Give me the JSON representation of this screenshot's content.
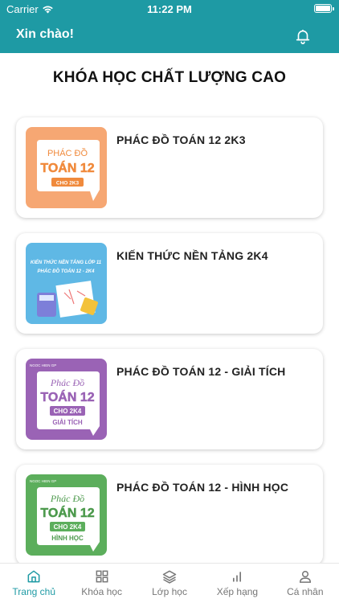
{
  "status_bar": {
    "carrier": "Carrier",
    "time": "11:22 PM"
  },
  "header": {
    "greeting": "Xin chào!",
    "bell_icon": "bell-icon"
  },
  "section": {
    "title": "KHÓA HỌC CHẤT LƯỢNG CAO"
  },
  "courses": [
    {
      "title": "PHÁC ĐỒ TOÁN 12 2K3",
      "thumb": {
        "line1": "PHÁC ĐỒ",
        "line2": "TOÁN 12",
        "line3": "CHO 2K3",
        "line4": "",
        "bg": "#f6a773"
      }
    },
    {
      "title": "KIẾN THỨC NỀN TẢNG 2K4",
      "thumb": {
        "line1": "KIẾN THỨC NỀN TẢNG LỚP 11",
        "line2": "PHÁC ĐỒ TOÁN 12 - 2K4",
        "bg": "#5fb8e5"
      }
    },
    {
      "title": "PHÁC ĐỒ TOÁN 12 - GIẢI TÍCH",
      "thumb": {
        "brand": "NGOC HIEN GP",
        "line1": "Phác Đồ",
        "line2": "TOÁN 12",
        "line3": "CHO 2K4",
        "line4": "GIẢI TÍCH",
        "bg": "#9a63b5"
      }
    },
    {
      "title": "PHÁC ĐỒ TOÁN 12 - HÌNH HỌC",
      "thumb": {
        "brand": "NGOC HIEN GP",
        "line1": "Phác Đồ",
        "line2": "TOÁN 12",
        "line3": "CHO 2K4",
        "line4": "HÌNH HỌC",
        "bg": "#5cae5c"
      }
    }
  ],
  "bottom_nav": [
    {
      "label": "Trang chủ",
      "icon": "home-icon",
      "active": true
    },
    {
      "label": "Khóa học",
      "icon": "grid-icon",
      "active": false
    },
    {
      "label": "Lớp học",
      "icon": "layers-icon",
      "active": false
    },
    {
      "label": "Xếp hạng",
      "icon": "bar-chart-icon",
      "active": false
    },
    {
      "label": "Cá nhân",
      "icon": "user-icon",
      "active": false
    }
  ],
  "colors": {
    "primary": "#1e9aa4",
    "active_nav": "#1e9aa4",
    "inactive_nav": "#777777"
  }
}
